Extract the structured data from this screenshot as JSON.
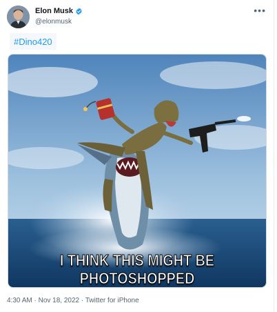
{
  "tweet": {
    "author_name": "Elon Musk",
    "author_handle": "@elonmusk",
    "verified_icon": "verified-badge-icon",
    "more_icon": "more-options-icon",
    "hashtag": "#Dino420",
    "meme_line_1": "I THINK THIS MIGHT BE",
    "meme_line_2": "PHOTOSHOPPED",
    "time": "4:30 AM",
    "separator": " · ",
    "date": "Nov 18, 2022",
    "source": "Twitter for iPhone"
  },
  "colors": {
    "accent": "#1d9bf0",
    "text_secondary": "#536471"
  }
}
